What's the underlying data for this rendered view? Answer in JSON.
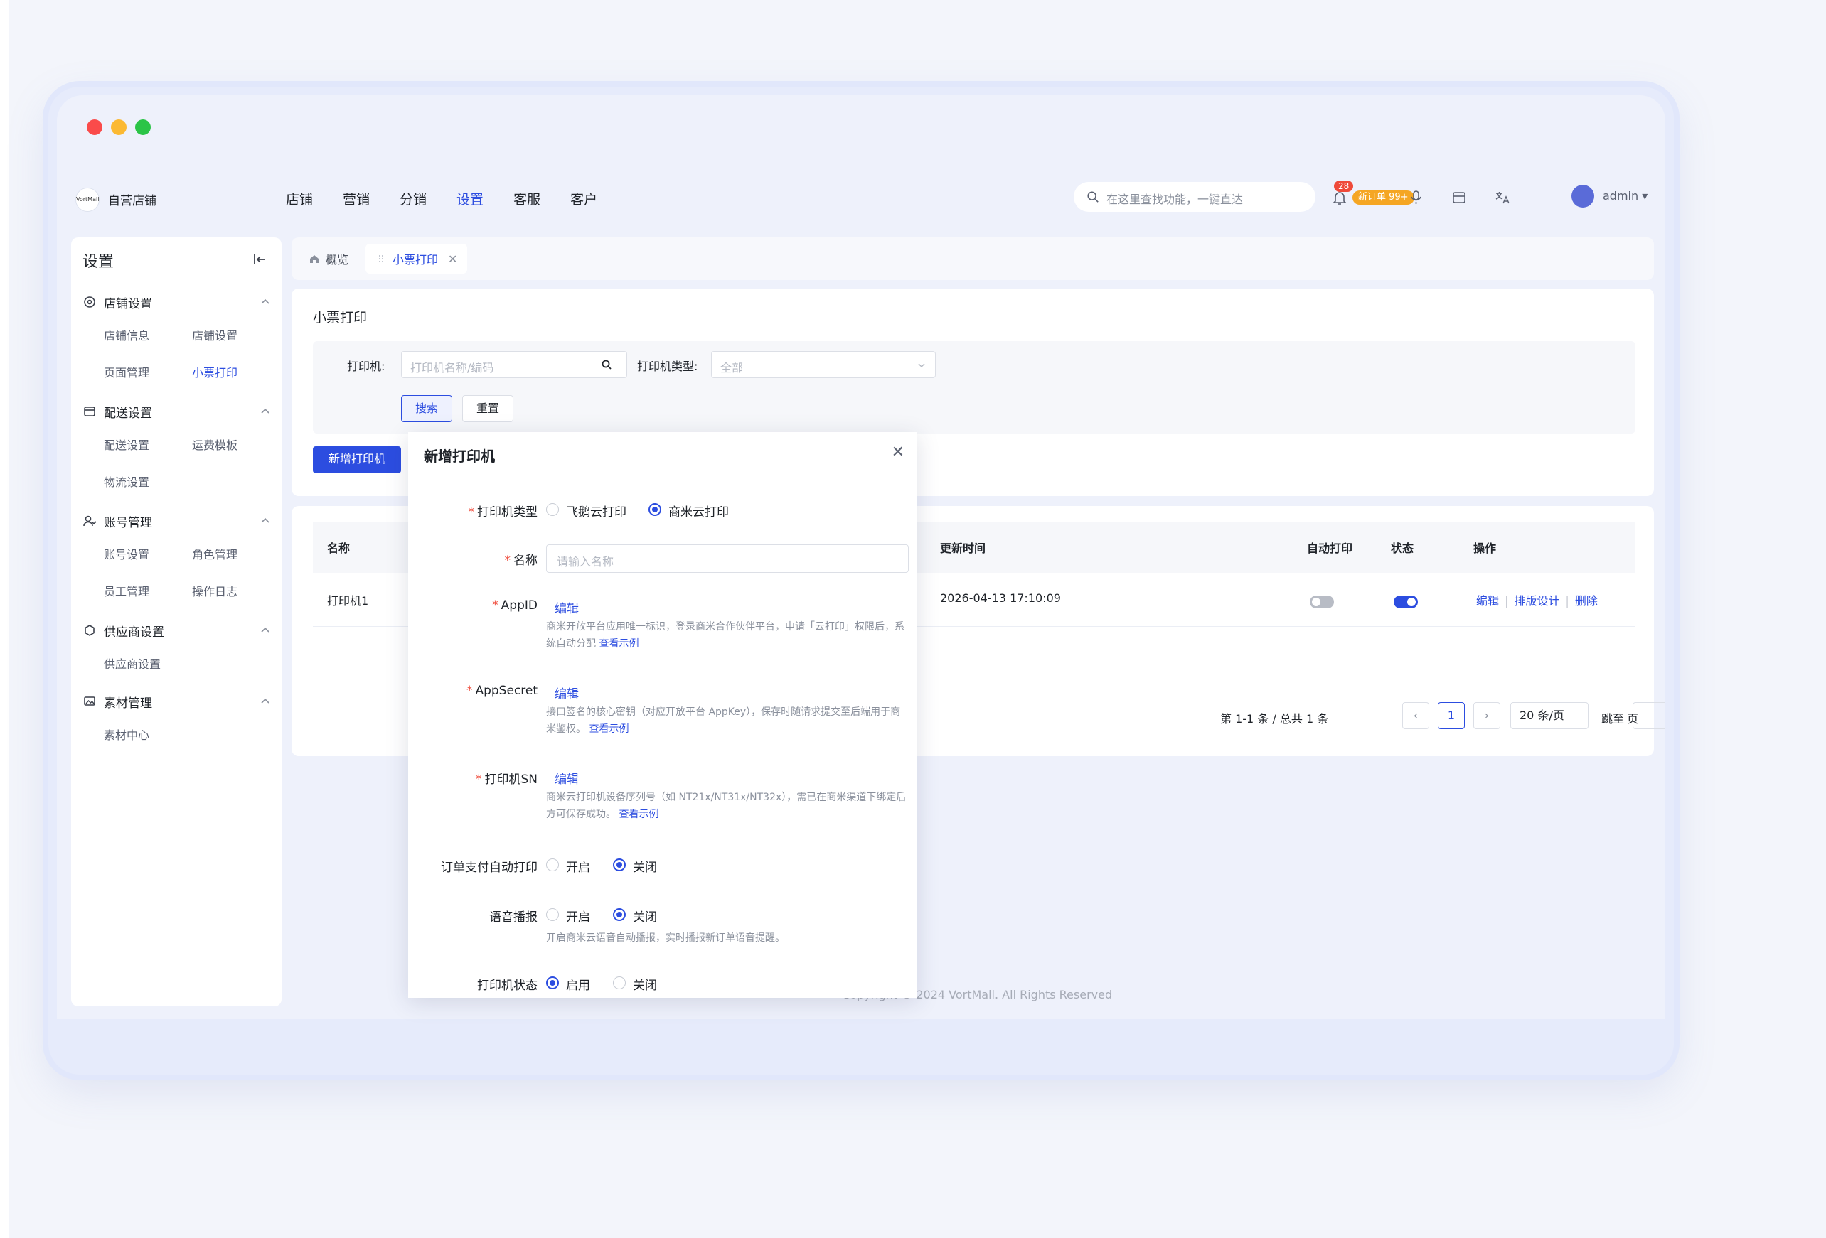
{
  "app": {
    "shop_name": "自营店铺",
    "logo_text": "VortMall"
  },
  "nav": [
    "店铺",
    "营销",
    "分销",
    "设置",
    "客服",
    "客户"
  ],
  "nav_active_index": 3,
  "header": {
    "search_placeholder": "在这里查找功能，一键直达",
    "notification_count": "28",
    "new_orders": "新订单 99+",
    "user": "admin"
  },
  "sidebar": {
    "title": "设置",
    "groups": [
      {
        "label": "店铺设置",
        "icon": "store-settings-icon",
        "items": [
          "店铺信息",
          "店铺设置",
          "页面管理",
          "小票打印"
        ]
      },
      {
        "label": "配送设置",
        "icon": "delivery-icon",
        "items": [
          "配送设置",
          "运费模板",
          "物流设置"
        ]
      },
      {
        "label": "账号管理",
        "icon": "user-manage-icon",
        "items": [
          "账号设置",
          "角色管理",
          "员工管理",
          "操作日志"
        ]
      },
      {
        "label": "供应商设置",
        "icon": "supplier-icon",
        "items": [
          "供应商设置"
        ]
      },
      {
        "label": "素材管理",
        "icon": "material-icon",
        "items": [
          "素材中心"
        ]
      }
    ],
    "active_item": "小票打印"
  },
  "tabs": {
    "home": "概览",
    "active": "小票打印"
  },
  "page": {
    "title": "小票打印",
    "filter": {
      "printer_label": "打印机:",
      "printer_placeholder": "打印机名称/编码",
      "type_label": "打印机类型:",
      "type_value": "全部",
      "search_button": "搜索",
      "reset_button": "重置"
    },
    "add_button": "新增打印机"
  },
  "table": {
    "columns": [
      "名称",
      "更新时间",
      "自动打印",
      "状态",
      "操作"
    ],
    "rows": [
      {
        "name": "打印机1",
        "updated": "2026-04-13 17:10:09",
        "auto_print": false,
        "status": true,
        "actions": [
          "编辑",
          "排版设计",
          "删除"
        ]
      }
    ],
    "pagination": {
      "summary": "第 1-1 条 / 总共 1 条",
      "current_page": "1",
      "page_size": "20 条/页",
      "jump_label": "跳至",
      "page_suffix": "页"
    }
  },
  "footer": {
    "copyright": "Copyright © 2024 VortMall. All Rights Reserved"
  },
  "modal": {
    "title": "新增打印机",
    "printer_type_label": "打印机类型",
    "printer_type_options": [
      "飞鹅云打印",
      "商米云打印"
    ],
    "printer_type_selected": "商米云打印",
    "name_label": "名称",
    "name_placeholder": "请输入名称",
    "appid_label": "AppID",
    "appid_edit": "编辑",
    "appid_help": "商米开放平台应用唯一标识，登录商米合作伙伴平台，申请「云打印」权限后，系统自动分配",
    "appid_help_link": "查看示例",
    "appsecret_label": "AppSecret",
    "appsecret_edit": "编辑",
    "appsecret_help": "接口签名的核心密钥（对应开放平台 AppKey），保存时随请求提交至后端用于商米鉴权。",
    "appsecret_help_link": "查看示例",
    "sn_label": "打印机SN",
    "sn_edit": "编辑",
    "sn_help": "商米云打印机设备序列号（如 NT21x/NT31x/NT32x），需已在商米渠道下绑定后方可保存成功。",
    "sn_help_link": "查看示例",
    "auto_print_label": "订单支付自动打印",
    "auto_print_options": [
      "开启",
      "关闭"
    ],
    "auto_print_selected": "关闭",
    "voice_label": "语音播报",
    "voice_options": [
      "开启",
      "关闭"
    ],
    "voice_selected": "关闭",
    "voice_help": "开启商米云语音自动播报，实时播报新订单语音提醒。",
    "status_label": "打印机状态",
    "status_options": [
      "启用",
      "关闭"
    ],
    "status_selected": "启用"
  },
  "colors": {
    "primary": "#2c4de0",
    "danger": "#ef4a3a",
    "warning": "#f5a623"
  }
}
